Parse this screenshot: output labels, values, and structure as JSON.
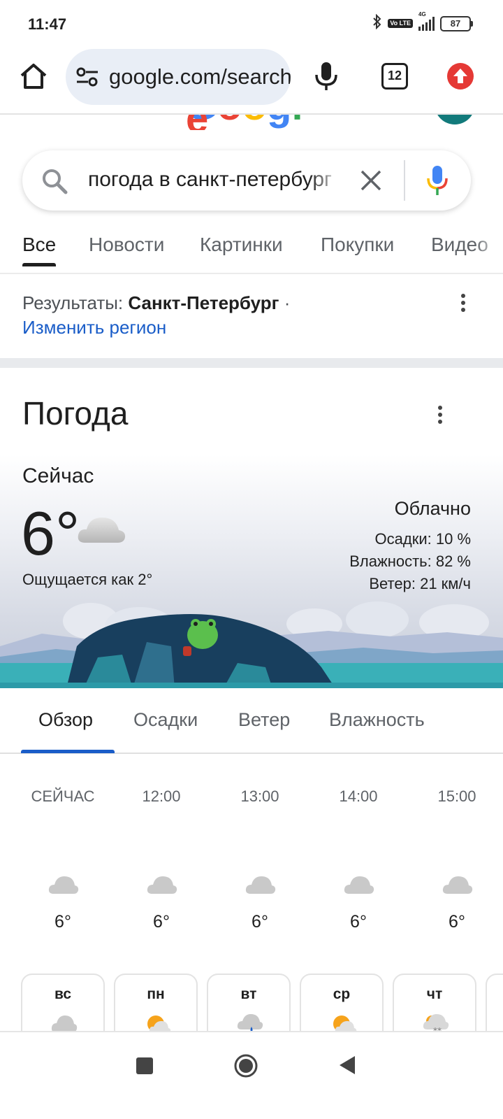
{
  "status_bar": {
    "time": "11:47",
    "network": "4G",
    "volte": "Vo LTE",
    "battery": "87"
  },
  "browser": {
    "url": "google.com/search",
    "tab_count": "12"
  },
  "search": {
    "query": "погода в санкт-петербург",
    "tabs": [
      "Все",
      "Новости",
      "Картинки",
      "Покупки",
      "Видео"
    ]
  },
  "region": {
    "prefix": "Результаты: ",
    "city": "Санкт-Петербург",
    "suffix": " ·",
    "change_link": "Изменить регион"
  },
  "weather": {
    "title": "Погода",
    "now_label": "Сейчас",
    "temperature": "6°",
    "feels_like": "Ощущается как 2°",
    "condition": "Облачно",
    "precipitation": "Осадки: 10 %",
    "humidity": "Влажность: 82 %",
    "wind": "Ветер: 21 км/ч",
    "tabs": [
      "Обзор",
      "Осадки",
      "Ветер",
      "Влажность"
    ],
    "hourly": [
      {
        "time": "СЕЙЧАС",
        "temp": "6°",
        "icon": "cloud-icon"
      },
      {
        "time": "12:00",
        "temp": "6°",
        "icon": "cloud-icon"
      },
      {
        "time": "13:00",
        "temp": "6°",
        "icon": "cloud-icon"
      },
      {
        "time": "14:00",
        "temp": "6°",
        "icon": "cloud-icon"
      },
      {
        "time": "15:00",
        "temp": "6°",
        "icon": "cloud-icon"
      }
    ],
    "daily": [
      {
        "day": "вс",
        "icon": "cloud-icon"
      },
      {
        "day": "пн",
        "icon": "partly-sunny-icon"
      },
      {
        "day": "вт",
        "icon": "rain-cloud-icon"
      },
      {
        "day": "ср",
        "icon": "partly-sunny-icon"
      },
      {
        "day": "чт",
        "icon": "snow-cloud-icon"
      }
    ]
  },
  "colors": {
    "link_blue": "#1a5dc8",
    "urlbar_bg": "#e9eef6",
    "update_red": "#e53935",
    "mic_blue": "#4285f4"
  }
}
